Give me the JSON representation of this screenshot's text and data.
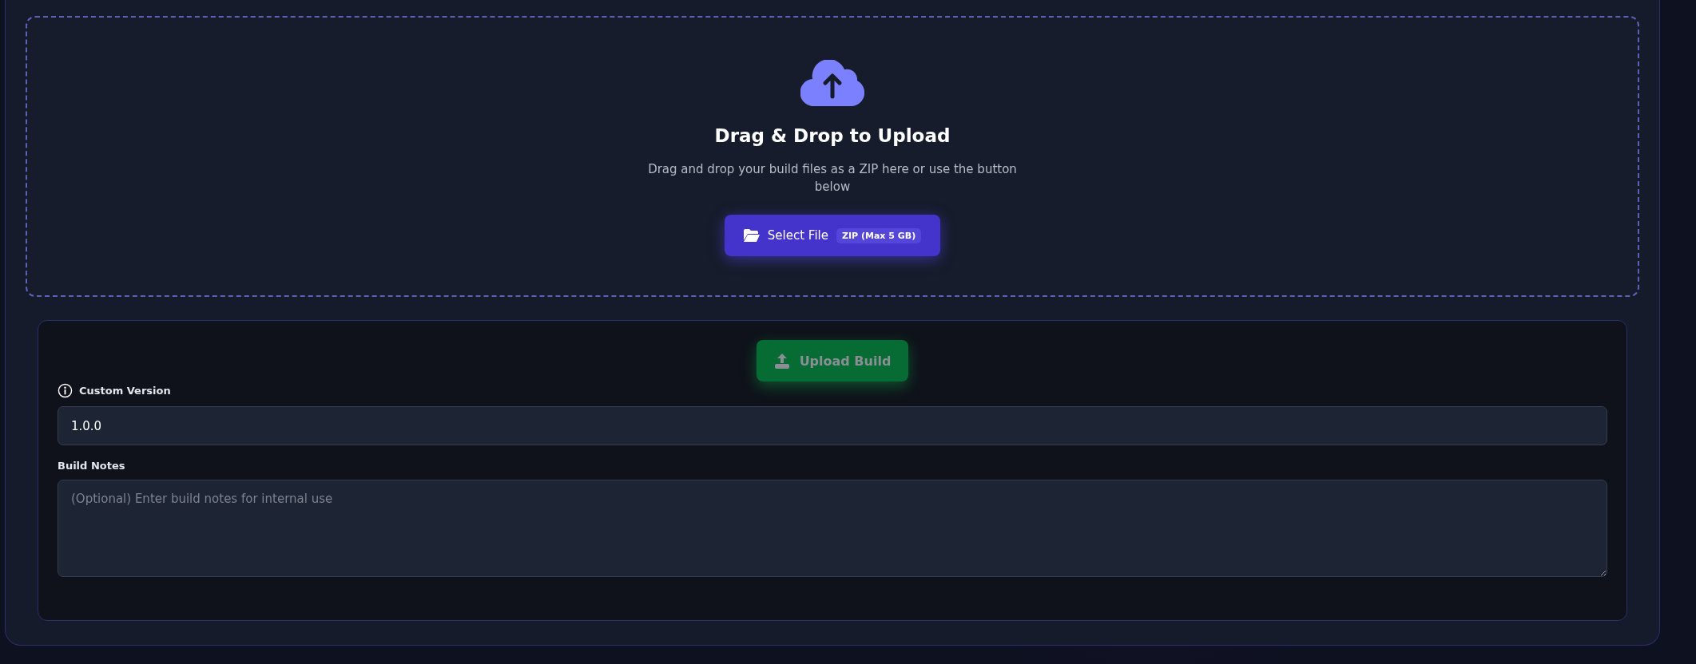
{
  "dropzone": {
    "title": "Drag & Drop to Upload",
    "description": "Drag and drop your build files as a ZIP here or use the button below",
    "button": {
      "label": "Select File",
      "badge": "ZIP (Max 5 GB)"
    }
  },
  "form": {
    "upload_button": {
      "label": "Upload Build",
      "disabled": true
    },
    "fields": [
      {
        "kind": "input",
        "label": "Custom Version",
        "info": true,
        "value": "1.0.0"
      },
      {
        "kind": "textarea",
        "label": "Build Notes",
        "info": false,
        "placeholder": "(Optional) Enter build notes for internal use"
      }
    ]
  }
}
